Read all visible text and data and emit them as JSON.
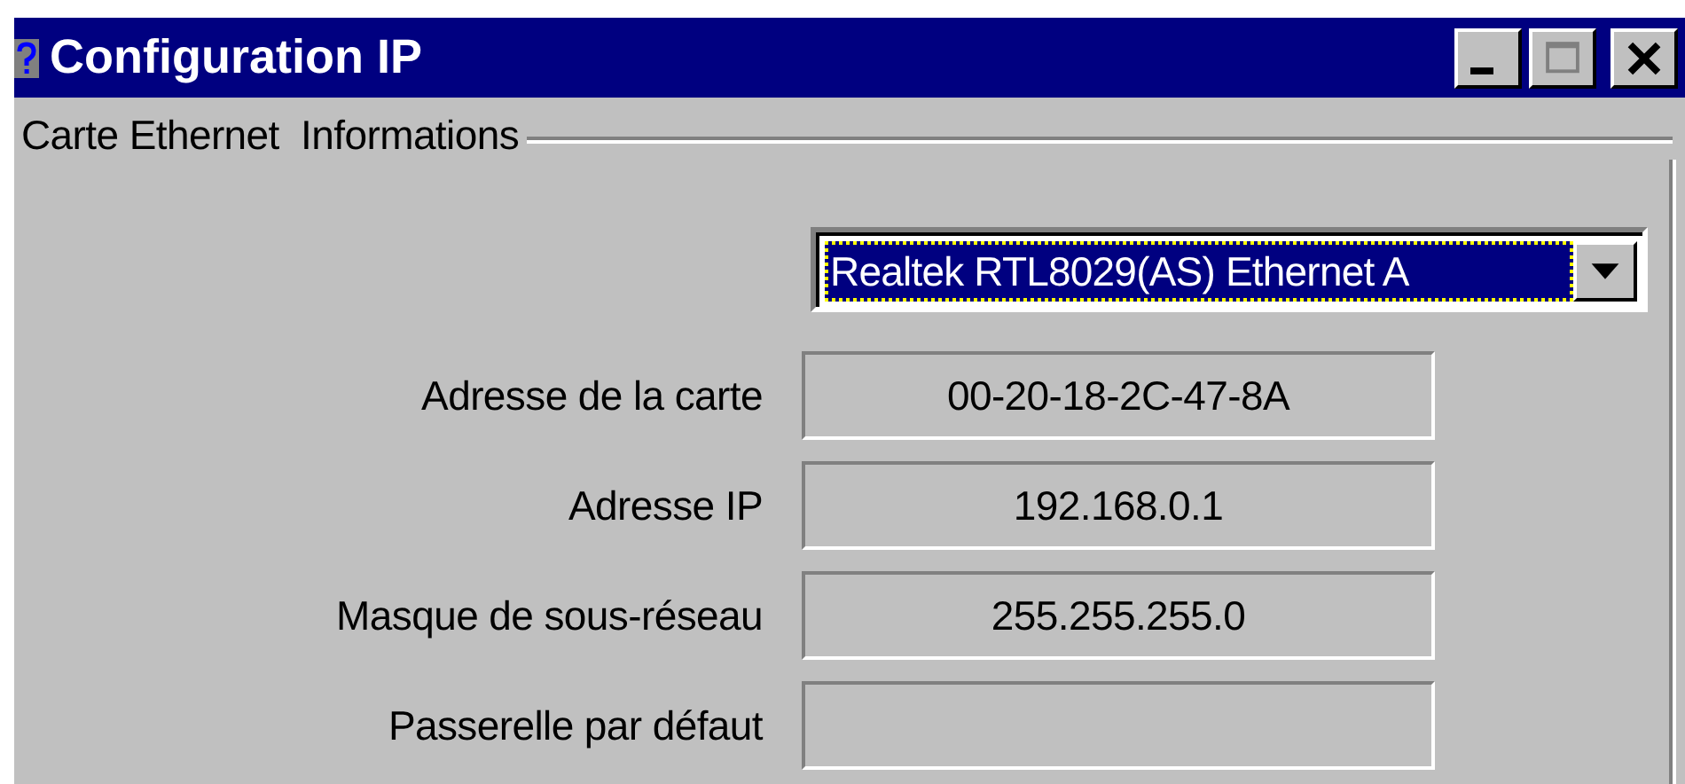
{
  "window": {
    "title": "Configuration IP"
  },
  "group": {
    "label": "Carte Ethernet  Informations"
  },
  "adapter": {
    "value": "Realtek RTL8029(AS) Ethernet A",
    "focused": true
  },
  "fields": [
    {
      "label": "Adresse de la carte",
      "value": "00-20-18-2C-47-8A"
    },
    {
      "label": "Adresse IP",
      "value": "192.168.0.1"
    },
    {
      "label": "Masque de sous-réseau",
      "value": "255.255.255.0"
    },
    {
      "label": "Passerelle par défaut"
    }
  ]
}
